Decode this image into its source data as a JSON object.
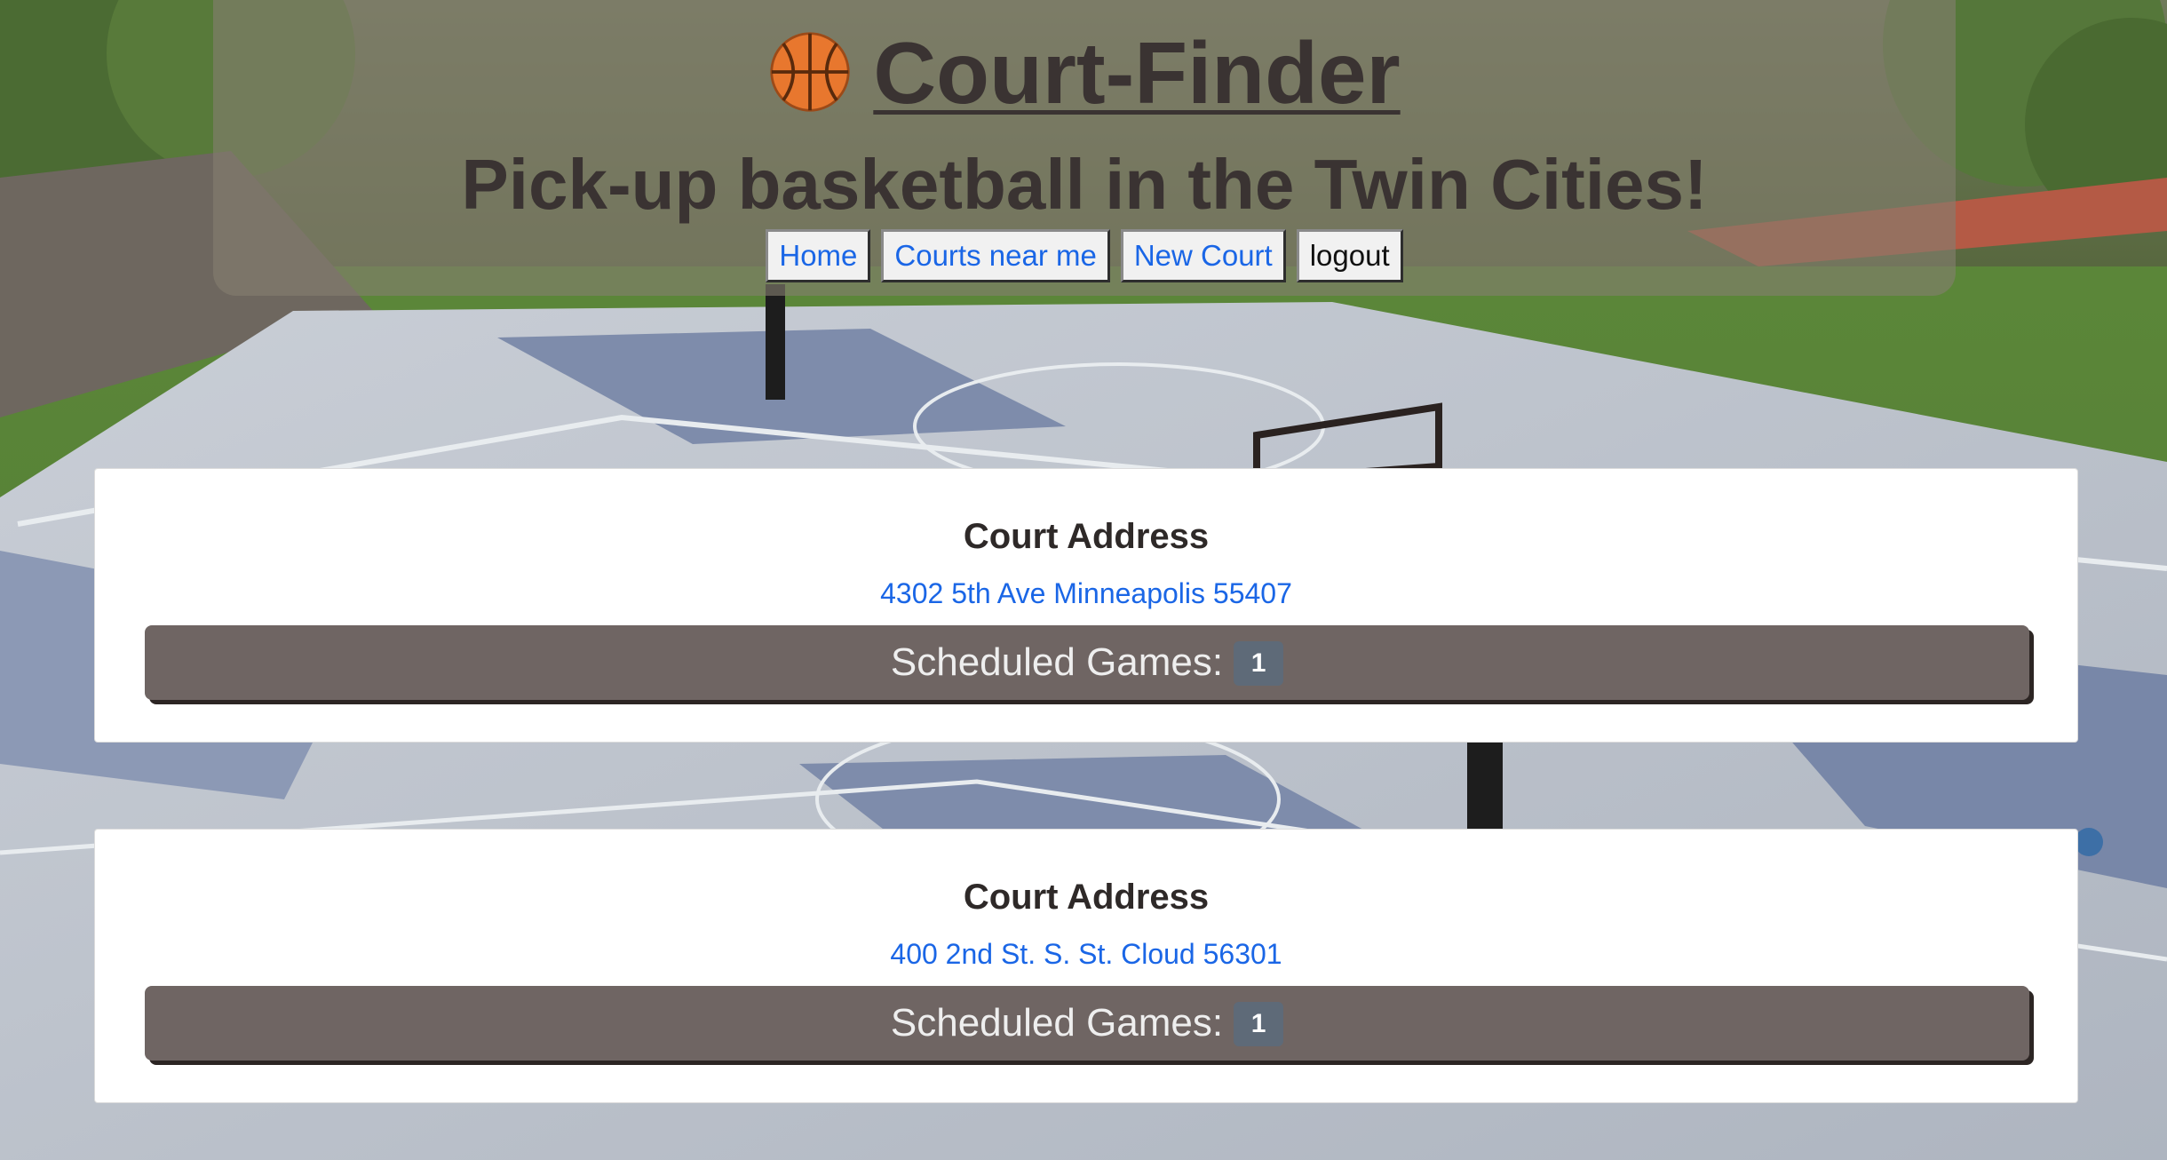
{
  "header": {
    "brand_emoji": "🏀",
    "brand_title": "Court-Finder",
    "tagline": "Pick-up basketball in the Twin Cities!",
    "nav": [
      {
        "label": "Home"
      },
      {
        "label": "Courts near me"
      },
      {
        "label": "New Court"
      },
      {
        "label": "logout"
      }
    ]
  },
  "courts": [
    {
      "heading": "Court Address",
      "address": "4302 5th Ave Minneapolis 55407",
      "games_label": "Scheduled Games:",
      "games_count": "1"
    },
    {
      "heading": "Court Address",
      "address": "400 2nd St. S. St. Cloud 56301",
      "games_label": "Scheduled Games:",
      "games_count": "1"
    }
  ],
  "colors": {
    "header_text": "#3a3332",
    "link": "#1a66e6",
    "games_button": "#6f6563",
    "badge": "#5e6a78"
  }
}
